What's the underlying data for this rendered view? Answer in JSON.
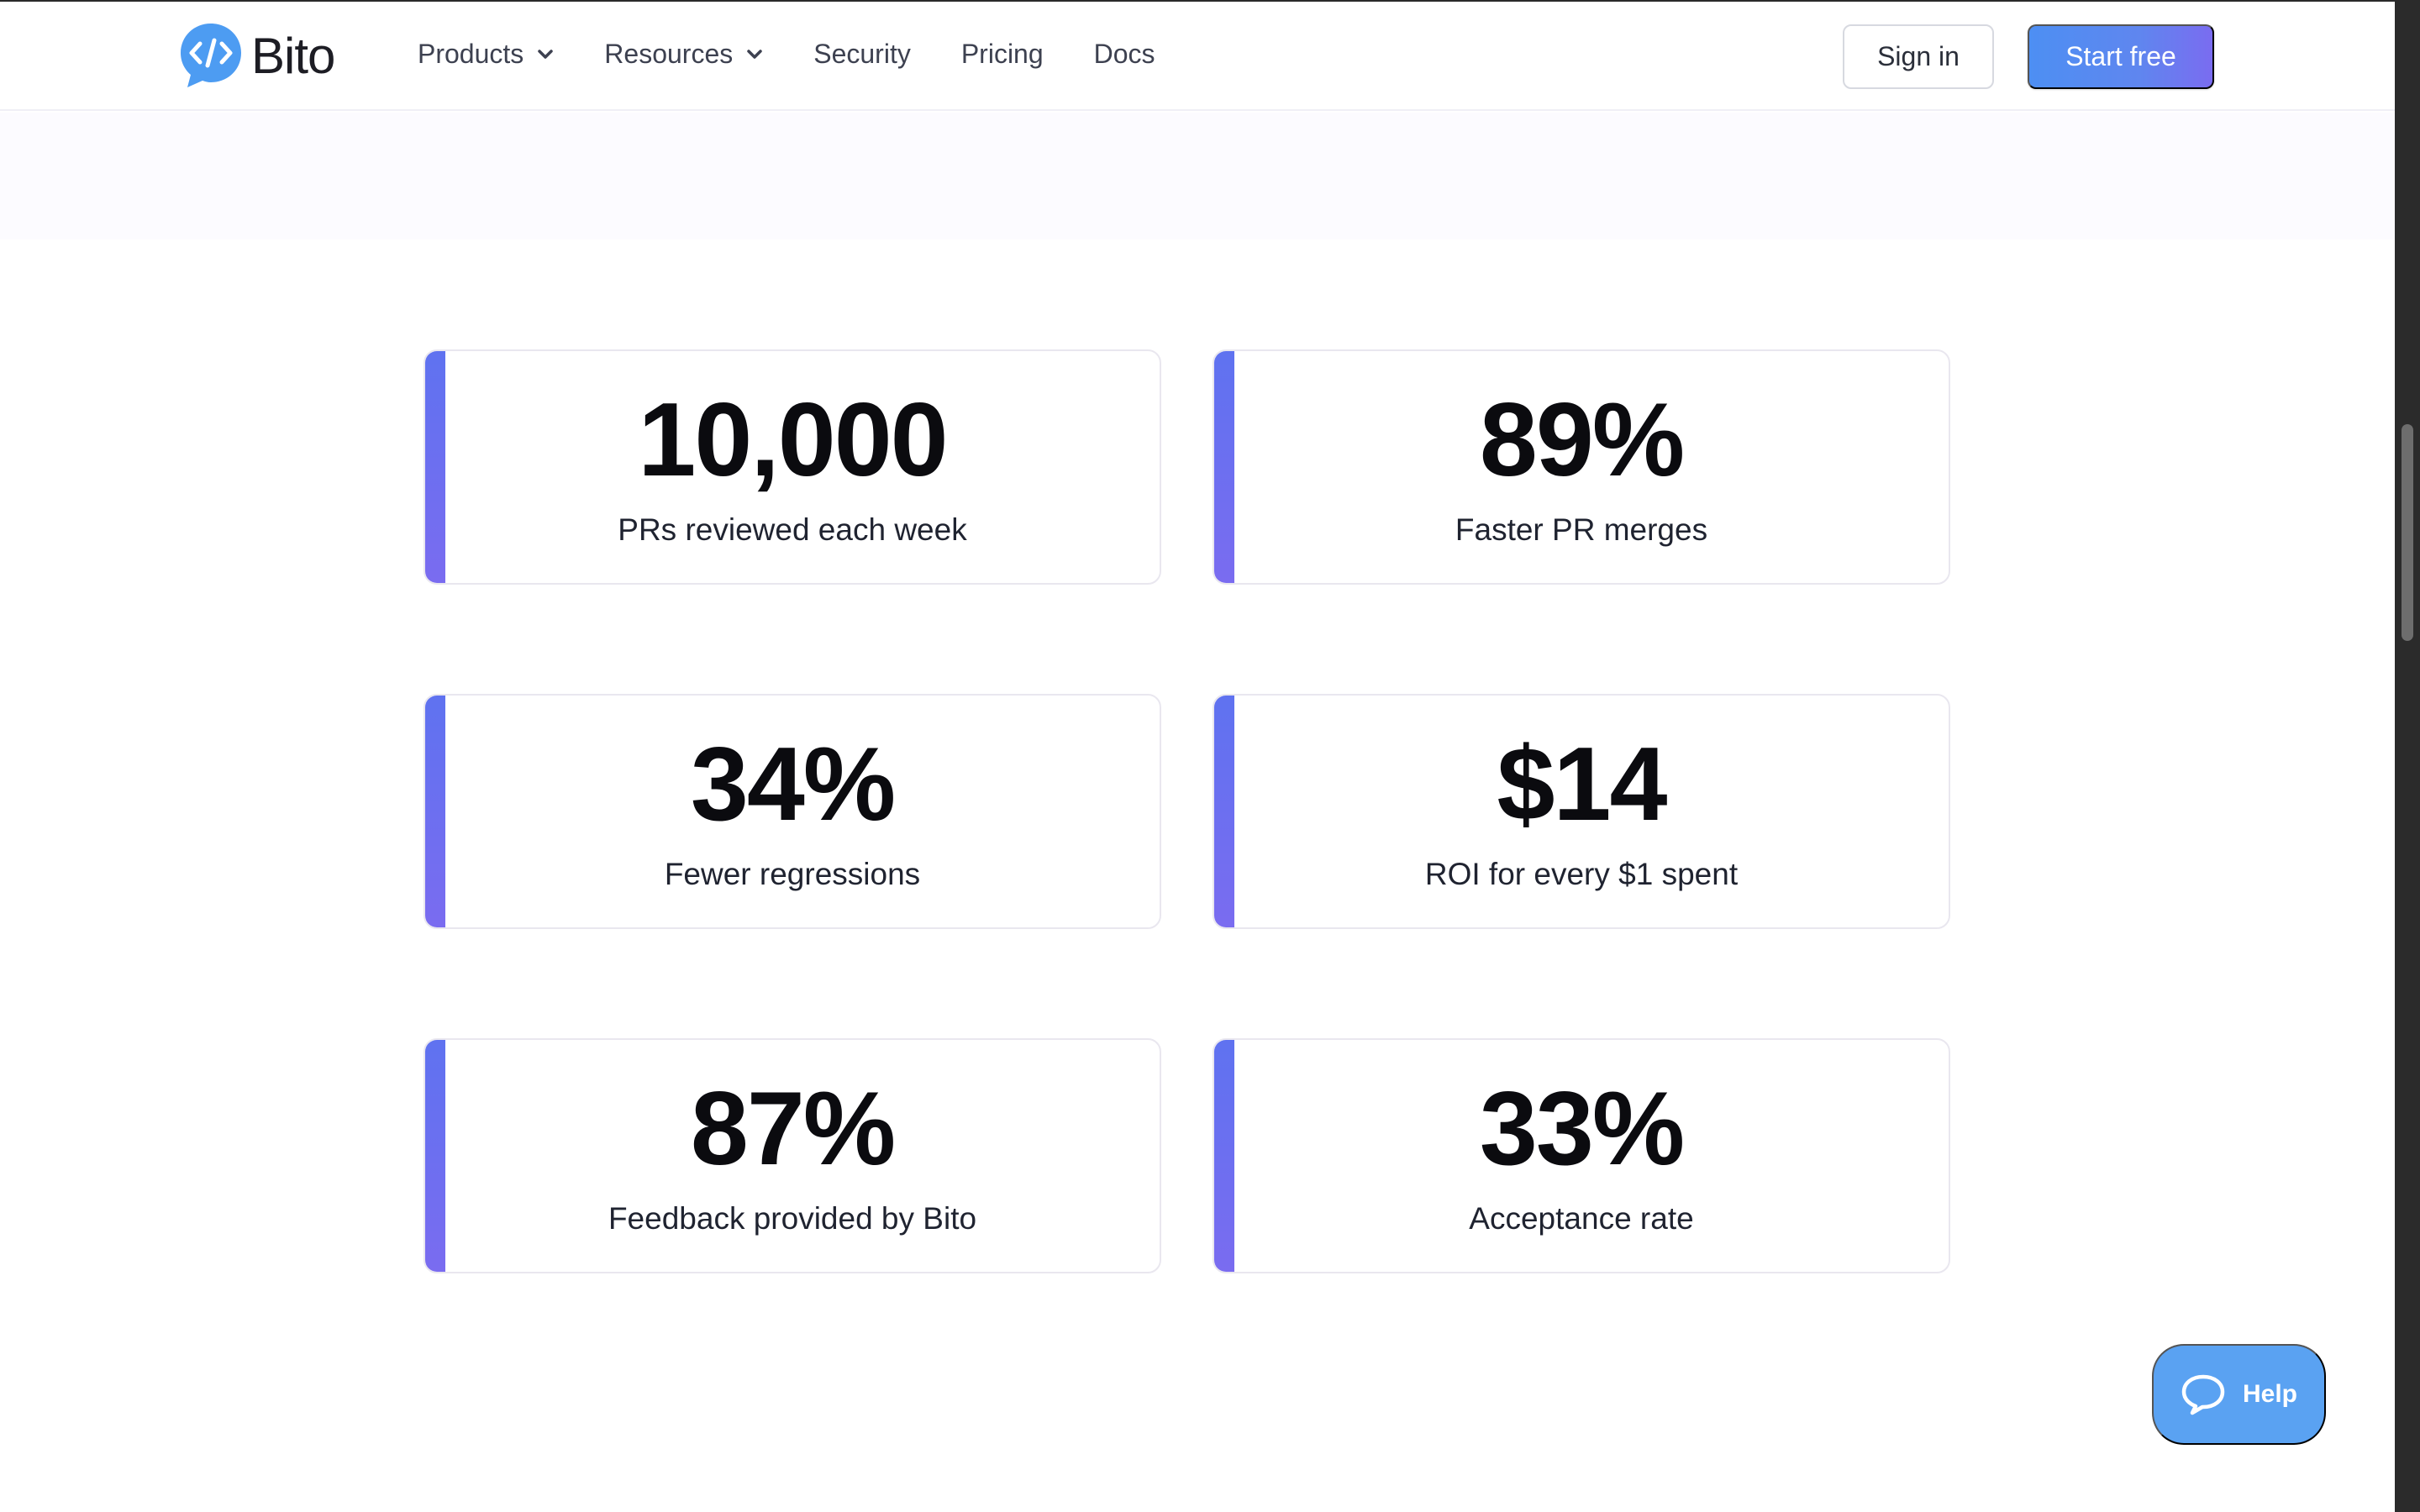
{
  "brand": {
    "name": "Bito"
  },
  "nav": {
    "items": [
      {
        "label": "Products",
        "dropdown": true
      },
      {
        "label": "Resources",
        "dropdown": true
      },
      {
        "label": "Security",
        "dropdown": false
      },
      {
        "label": "Pricing",
        "dropdown": false
      },
      {
        "label": "Docs",
        "dropdown": false
      }
    ],
    "sign_in": "Sign in",
    "start_free": "Start free"
  },
  "stats": [
    {
      "value": "10,000",
      "label": "PRs reviewed each week"
    },
    {
      "value": "89%",
      "label": "Faster PR merges"
    },
    {
      "value": "34%",
      "label": "Fewer regressions"
    },
    {
      "value": "$14",
      "label": "ROI for every $1 spent"
    },
    {
      "value": "87%",
      "label": "Feedback provided by Bito"
    },
    {
      "value": "33%",
      "label": "Acceptance rate"
    }
  ],
  "help": {
    "label": "Help"
  },
  "colors": {
    "brand_blue": "#4d8ff3",
    "accent_purple": "#7a6cf0",
    "help_blue": "#5aa2f2"
  },
  "icons": {
    "logo": "code-chat-bubble-icon",
    "dropdown": "chevron-down-icon",
    "help": "chat-bubble-icon"
  }
}
